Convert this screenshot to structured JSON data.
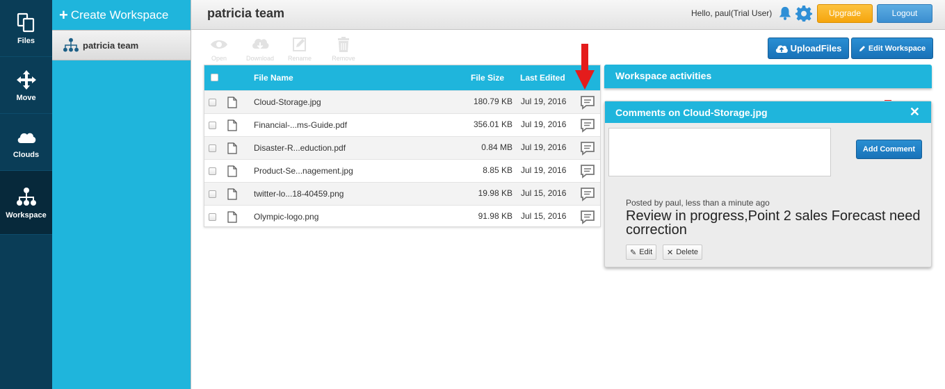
{
  "rail": {
    "items": [
      {
        "label": "Files"
      },
      {
        "label": "Move"
      },
      {
        "label": "Clouds"
      },
      {
        "label": "Workspace"
      }
    ]
  },
  "sidebar": {
    "create_label": "Create Workspace",
    "workspaces": [
      {
        "name": "patricia team"
      }
    ]
  },
  "header": {
    "title": "patricia team",
    "greeting": "Hello, paul(Trial User)",
    "upgrade_label": "Upgrade",
    "logout_label": "Logout"
  },
  "toolbar": {
    "open": "Open",
    "download": "Download",
    "rename": "Rename",
    "remove": "Remove",
    "upload_label": "UploadFiles",
    "edit_ws_label": "Edit Workspace"
  },
  "files": {
    "columns": {
      "name": "File Name",
      "size": "File Size",
      "edited": "Last Edited"
    },
    "rows": [
      {
        "name": "Cloud-Storage.jpg",
        "size": "180.79 KB",
        "date": "Jul 19, 2016"
      },
      {
        "name": "Financial-...ms-Guide.pdf",
        "size": "356.01 KB",
        "date": "Jul 19, 2016"
      },
      {
        "name": "Disaster-R...eduction.pdf",
        "size": "0.84 MB",
        "date": "Jul 19, 2016"
      },
      {
        "name": "Product-Se...nagement.jpg",
        "size": "8.85 KB",
        "date": "Jul 19, 2016"
      },
      {
        "name": "twitter-lo...18-40459.png",
        "size": "19.98 KB",
        "date": "Jul 15, 2016"
      },
      {
        "name": "Olympic-logo.png",
        "size": "91.98 KB",
        "date": "Jul 15, 2016"
      }
    ]
  },
  "activities": {
    "title": "Workspace activities"
  },
  "comments": {
    "title": "Comments on Cloud-Storage.jpg",
    "add_label": "Add Comment",
    "posted_by": "Posted by paul, less than a minute ago",
    "text": "Review in progress,Point 2 sales Forecast need correction",
    "edit_label": "Edit",
    "delete_label": "Delete"
  },
  "colors": {
    "accent": "#1fb5dc",
    "rail": "#0a3d57",
    "upgrade": "#f5a50d",
    "button": "#1872b8",
    "arrow": "#e41c1c"
  },
  "icons": [
    "files-icon",
    "move-icon",
    "clouds-icon",
    "workspace-icon",
    "bell-icon",
    "gear-icon",
    "comment-icon",
    "document-icon",
    "close-icon"
  ]
}
